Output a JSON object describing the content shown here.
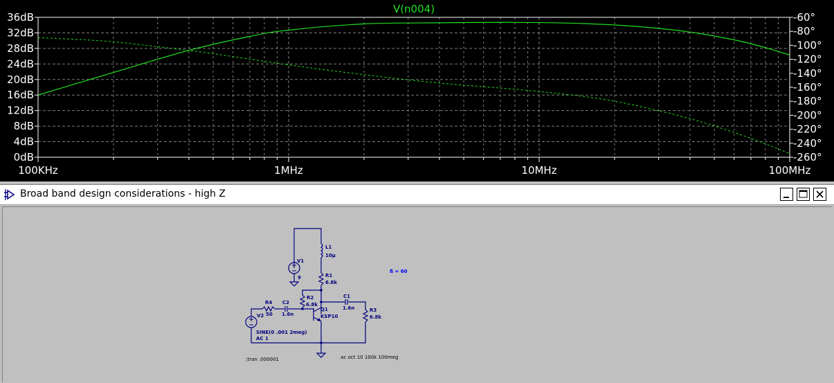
{
  "plot": {
    "trace_name": "V(n004)",
    "trace_color": "#20e020",
    "chart_data": {
      "type": "line",
      "title": "V(n004)",
      "x_scale": "log",
      "x_range_hz": [
        100000,
        100000000
      ],
      "x_tick_labels": [
        "100KHz",
        "1MHz",
        "10MHz",
        "100MHz"
      ],
      "y_left_range_db": [
        0,
        36
      ],
      "y_left_tick_labels": [
        "36dB",
        "32dB",
        "28dB",
        "24dB",
        "20dB",
        "16dB",
        "12dB",
        "8dB",
        "4dB",
        "0dB"
      ],
      "y_right_range_deg": [
        -260,
        -60
      ],
      "y_right_tick_labels": [
        "-60°",
        "-80°",
        "-100°",
        "-120°",
        "-140°",
        "-160°",
        "-180°",
        "-200°",
        "-220°",
        "-240°",
        "-260°"
      ],
      "grid": true,
      "series": [
        {
          "name": "V(n004)",
          "kind": "magnitude",
          "axis": "left",
          "style": "solid",
          "x": [
            100000,
            200000,
            400000,
            700000,
            1000000,
            2000000,
            4000000,
            8000000,
            15000000,
            25000000,
            40000000,
            60000000,
            80000000,
            100000000
          ],
          "y": [
            16.0,
            21.8,
            27.5,
            31.1,
            32.7,
            34.3,
            34.6,
            34.7,
            34.4,
            33.6,
            32.2,
            30.2,
            28.2,
            26.3
          ]
        },
        {
          "name": "V(n004) phase",
          "kind": "phase",
          "axis": "right",
          "style": "dashed",
          "x": [
            100000,
            150000,
            200000,
            300000,
            500000,
            1000000,
            2000000,
            4000000,
            10000000,
            20000000,
            40000000,
            70000000,
            100000000
          ],
          "y": [
            -89,
            -92,
            -95,
            -102,
            -112,
            -128,
            -142,
            -154,
            -166,
            -180,
            -205,
            -233,
            -255
          ]
        }
      ]
    }
  },
  "window": {
    "title": "Broad band design considerations - high Z",
    "icon": "ltspice-op-amp-icon",
    "buttons": [
      "minimize",
      "maximize",
      "close"
    ]
  },
  "schematic": {
    "V1": {
      "name": "V1",
      "value": "9"
    },
    "L1": {
      "name": "L1",
      "value": "10µ"
    },
    "R1": {
      "name": "R1",
      "value": "6.8k"
    },
    "R2": {
      "name": "R2",
      "value": "6.8k"
    },
    "C1": {
      "name": "C1",
      "value": "1.6n"
    },
    "C2": {
      "name": "C2",
      "value": "1.6n"
    },
    "R3": {
      "name": "R3",
      "value": "6.8k"
    },
    "R4": {
      "name": "R4",
      "value": "50"
    },
    "Q1": {
      "name": "Q1",
      "value": "KSP10"
    },
    "V2": {
      "name": "V2",
      "value1": "SINE(0 .001 2meg)",
      "value2": "AC 1"
    },
    "beta_note": "ß = 60",
    "tran_directive": ";tran .000001",
    "ac_directive": ".ac oct 10 100k 100meg"
  }
}
